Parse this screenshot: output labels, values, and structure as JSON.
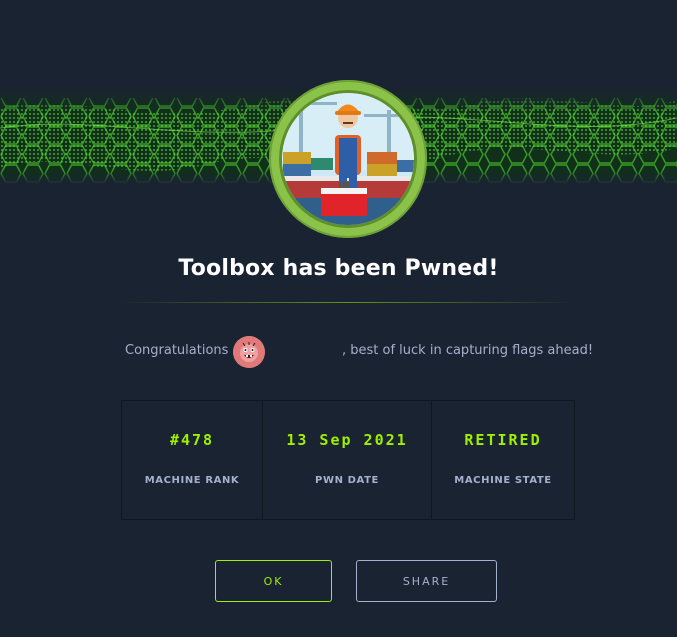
{
  "dialog": {
    "title": "Toolbox has been Pwned!",
    "congrats_prefix": "Congratulations",
    "congrats_suffix": ", best of luck in capturing flags ahead!",
    "stats": [
      {
        "value": "#478",
        "label": "MACHINE RANK"
      },
      {
        "value": "13 Sep 2021",
        "label": "PWN DATE"
      },
      {
        "value": "RETIRED",
        "label": "MACHINE STATE"
      }
    ],
    "buttons": {
      "ok": "OK",
      "share": "SHARE"
    }
  },
  "colors": {
    "background": "#1a2332",
    "accent": "#9fef00",
    "text_muted": "#a4b1cd",
    "avatar_ring": "#8bc34a",
    "user_avatar": "#e07a7a"
  },
  "icons": {
    "machine_avatar": "toolbox-worker-icon",
    "user_avatar": "user-avatar-icon",
    "banner": "green-hex-banner"
  }
}
